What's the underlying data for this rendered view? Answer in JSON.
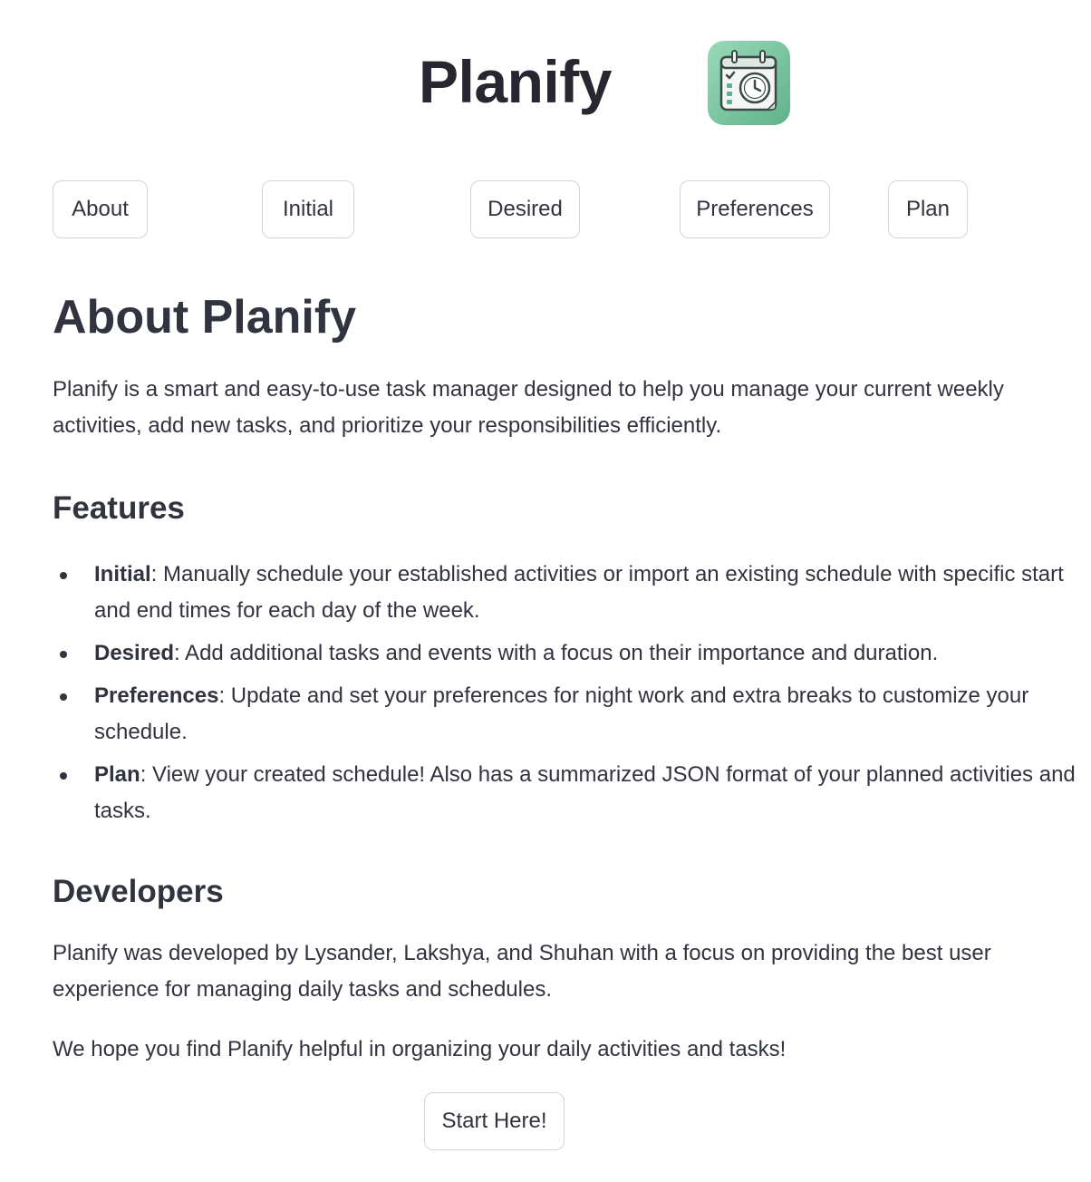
{
  "header": {
    "title": "Planify",
    "logo_icon": "calendar-clock-icon"
  },
  "nav": {
    "buttons": [
      {
        "label": "About"
      },
      {
        "label": "Initial"
      },
      {
        "label": "Desired"
      },
      {
        "label": "Preferences"
      },
      {
        "label": "Plan"
      }
    ]
  },
  "about": {
    "title": "About Planify",
    "intro": "Planify is a smart and easy-to-use task manager designed to help you manage your current weekly activities, add new tasks, and prioritize your responsibilities efficiently."
  },
  "features": {
    "heading": "Features",
    "items": [
      {
        "name": "Initial",
        "description": ": Manually schedule your established activities or import an existing schedule with specific start and end times for each day of the week."
      },
      {
        "name": "Desired",
        "description": ": Add additional tasks and events with a focus on their importance and duration."
      },
      {
        "name": "Preferences",
        "description": ": Update and set your preferences for night work and extra breaks to customize your schedule."
      },
      {
        "name": "Plan",
        "description": ": View your created schedule! Also has a summarized JSON format of your planned activities and tasks."
      }
    ]
  },
  "developers": {
    "heading": "Developers",
    "text": "Planify was developed by Lysander, Lakshya, and Shuhan with a focus on providing the best user experience for managing daily tasks and schedules.",
    "closing": "We hope you find Planify helpful in organizing your daily activities and tasks!"
  },
  "cta": {
    "label": "Start Here!"
  },
  "colors": {
    "text": "#31333f",
    "border": "#d3d4d9",
    "logo_bg": "#7cc9a2",
    "logo_accent": "#3f8f6a"
  }
}
